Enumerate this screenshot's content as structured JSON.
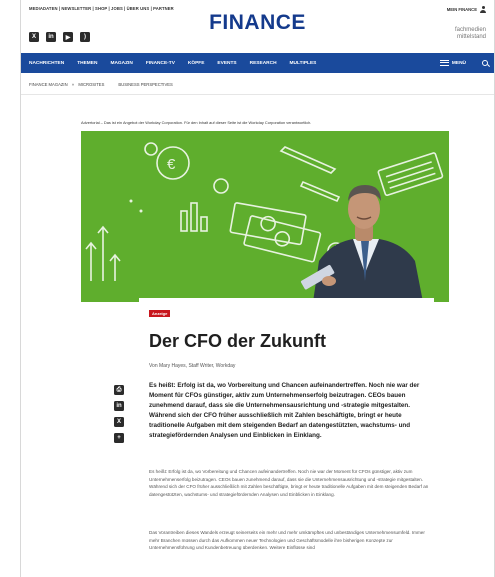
{
  "header": {
    "utility_links": "MEDIADATEN | NEWSLETTER | SHOP | JOBS | ÜBER UNS | PARTNER",
    "account_label": "MEIN FINANCE",
    "logo": "FINANCE",
    "publisher_line1": "fachmedien",
    "publisher_line2": "mittelstand"
  },
  "nav": {
    "items": [
      "NACHRICHTEN",
      "THEMEN",
      "MAGAZIN",
      "FINANCE-TV",
      "KÖPFE",
      "EVENTS",
      "RESEARCH",
      "MULTIPLES"
    ],
    "menu_label": "MENÜ"
  },
  "breadcrumb": {
    "path": "FINANCE MAGAZIN",
    "separator": "»",
    "current": "MICROSITES",
    "sub": "BUSINESS PERSPECTIVES"
  },
  "article": {
    "advertorial_note": "Advertorial – Das ist ein Angebot der Workday Corporation. Für den Inhalt auf dieser Seite ist die Workday Corporation verantwortlich.",
    "tag": "Anzeige",
    "title": "Der CFO der Zukunft",
    "byline": "Von Mary Hayes, Staff Writer, Workday",
    "lead": "Es heißt: Erfolg ist da, wo Vorbereitung und Chancen aufeinandertreffen. Noch nie war der Moment für CFOs günstiger, aktiv zum Unternehmenserfolg beizutragen. CEOs bauen zunehmend darauf, dass sie die Unternehmensausrichtung und -strategie mitgestalten. Während sich der CFO früher ausschließlich mit Zahlen beschäftigte, bringt er heute traditionelle Aufgaben mit dem steigenden Bedarf an datengestützten, wachstums- und strategiefördernden Analysen und Einblicken in Einklang.",
    "body1": "Es heißt: Erfolg ist da, wo Vorbereitung und Chancen aufeinandertreffen. Noch nie war der Moment für CFOs günstiger, aktiv zum Unternehmenserfolg beizutragen. CEOs bauen zunehmend darauf, dass sie die Unternehmensausrichtung und -strategie mitgestalten. Während sich der CFO früher ausschließlich mit Zahlen beschäftigte, bringt er heute traditionelle Aufgaben mit dem steigenden Bedarf an datengestützten, wachstums- und strategiefördernden Analysen und Einblicken in Einklang.",
    "body2": "Das Vorantreiben dieses Wandels erzeugt seinerseits ein mehr und mehr umkämpftes und unbeständiges Unternehmensumfeld. Immer mehr Branchen müssen durch das Aufkommen neuer Technologien und Geschäftsmodelle ihre bisherigen Konzepte zur Unternehmensführung und Kundenbetreuung überdenken. Weitere Einflüsse sind"
  },
  "colors": {
    "brand_blue": "#1a4a9c",
    "hero_green": "#5fae2d",
    "tag_red": "#c8161d"
  }
}
